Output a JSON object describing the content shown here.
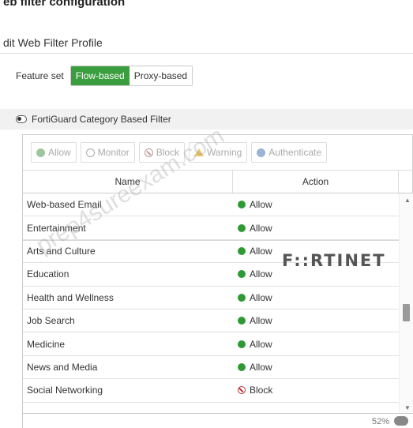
{
  "caption": "eb filter configuration",
  "title": "dit Web Filter Profile",
  "feature_set": {
    "label": "Feature set",
    "options": [
      "Flow-based",
      "Proxy-based"
    ],
    "selected": "Flow-based"
  },
  "section": {
    "title": "FortiGuard Category Based Filter",
    "enabled": true
  },
  "toolbar": {
    "buttons": [
      "Allow",
      "Monitor",
      "Block",
      "Warning",
      "Authenticate"
    ]
  },
  "table": {
    "columns": [
      "Name",
      "Action"
    ],
    "rows": [
      {
        "name": "Web-based Email",
        "action": "Allow"
      },
      {
        "name": "Entertainment",
        "action": "Allow"
      },
      {
        "name": "Arts and Culture",
        "action": "Allow"
      },
      {
        "name": "Education",
        "action": "Allow"
      },
      {
        "name": "Health and Wellness",
        "action": "Allow"
      },
      {
        "name": "Job Search",
        "action": "Allow"
      },
      {
        "name": "Medicine",
        "action": "Allow"
      },
      {
        "name": "News and Media",
        "action": "Allow"
      },
      {
        "name": "Social Networking",
        "action": "Block"
      }
    ]
  },
  "zoom_text": "52%",
  "watermark": "prep4sureexam.com",
  "logo": "F::RTINET",
  "colors": {
    "accent": "#3a9d3e",
    "allow": "#2f9a35",
    "block": "#bb3333"
  }
}
